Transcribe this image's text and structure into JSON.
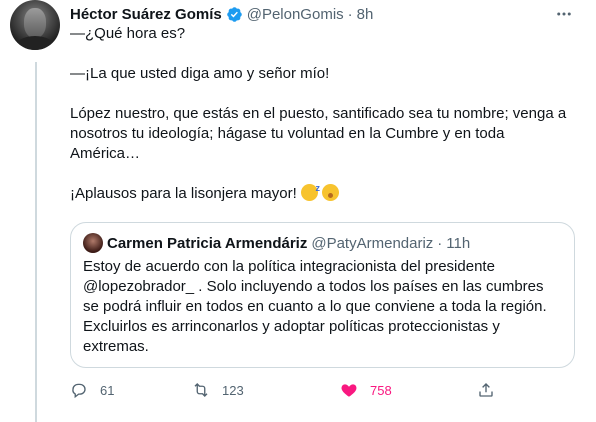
{
  "tweet": {
    "author_name": "Héctor Suárez Gomís",
    "handle": "@PelonGomis",
    "separator": "·",
    "time": "8h",
    "lines": [
      "—¿Qué hora es?",
      "—¡La que usted diga amo y señor mío!",
      "López nuestro, que estás en el puesto, santificado sea tu nombre; venga a nosotros tu ideología; hágase tu voluntad en la Cumbre y en toda América…",
      "¡Aplausos para la lisonjera mayor!"
    ],
    "emojis": [
      "yawning-face",
      "sleeping-face"
    ]
  },
  "quoted": {
    "author_name": "Carmen Patricia Armendáriz",
    "handle": "@PatyArmendariz",
    "separator": "·",
    "time": "11h",
    "text": "Estoy de acuerdo con la política integracionista del presidente @lopezobrador_ . Solo incluyendo a todos los países en las cumbres se podrá influir en todos en cuanto a lo que conviene a toda la región. Excluirlos es arrinconarlos y adoptar políticas proteccionistas y extremas."
  },
  "actions": {
    "replies": "61",
    "retweets": "123",
    "likes": "758"
  },
  "colors": {
    "verified": "#1d9bf0",
    "like": "#f91880",
    "muted": "#536471",
    "border": "#cfd9de"
  }
}
